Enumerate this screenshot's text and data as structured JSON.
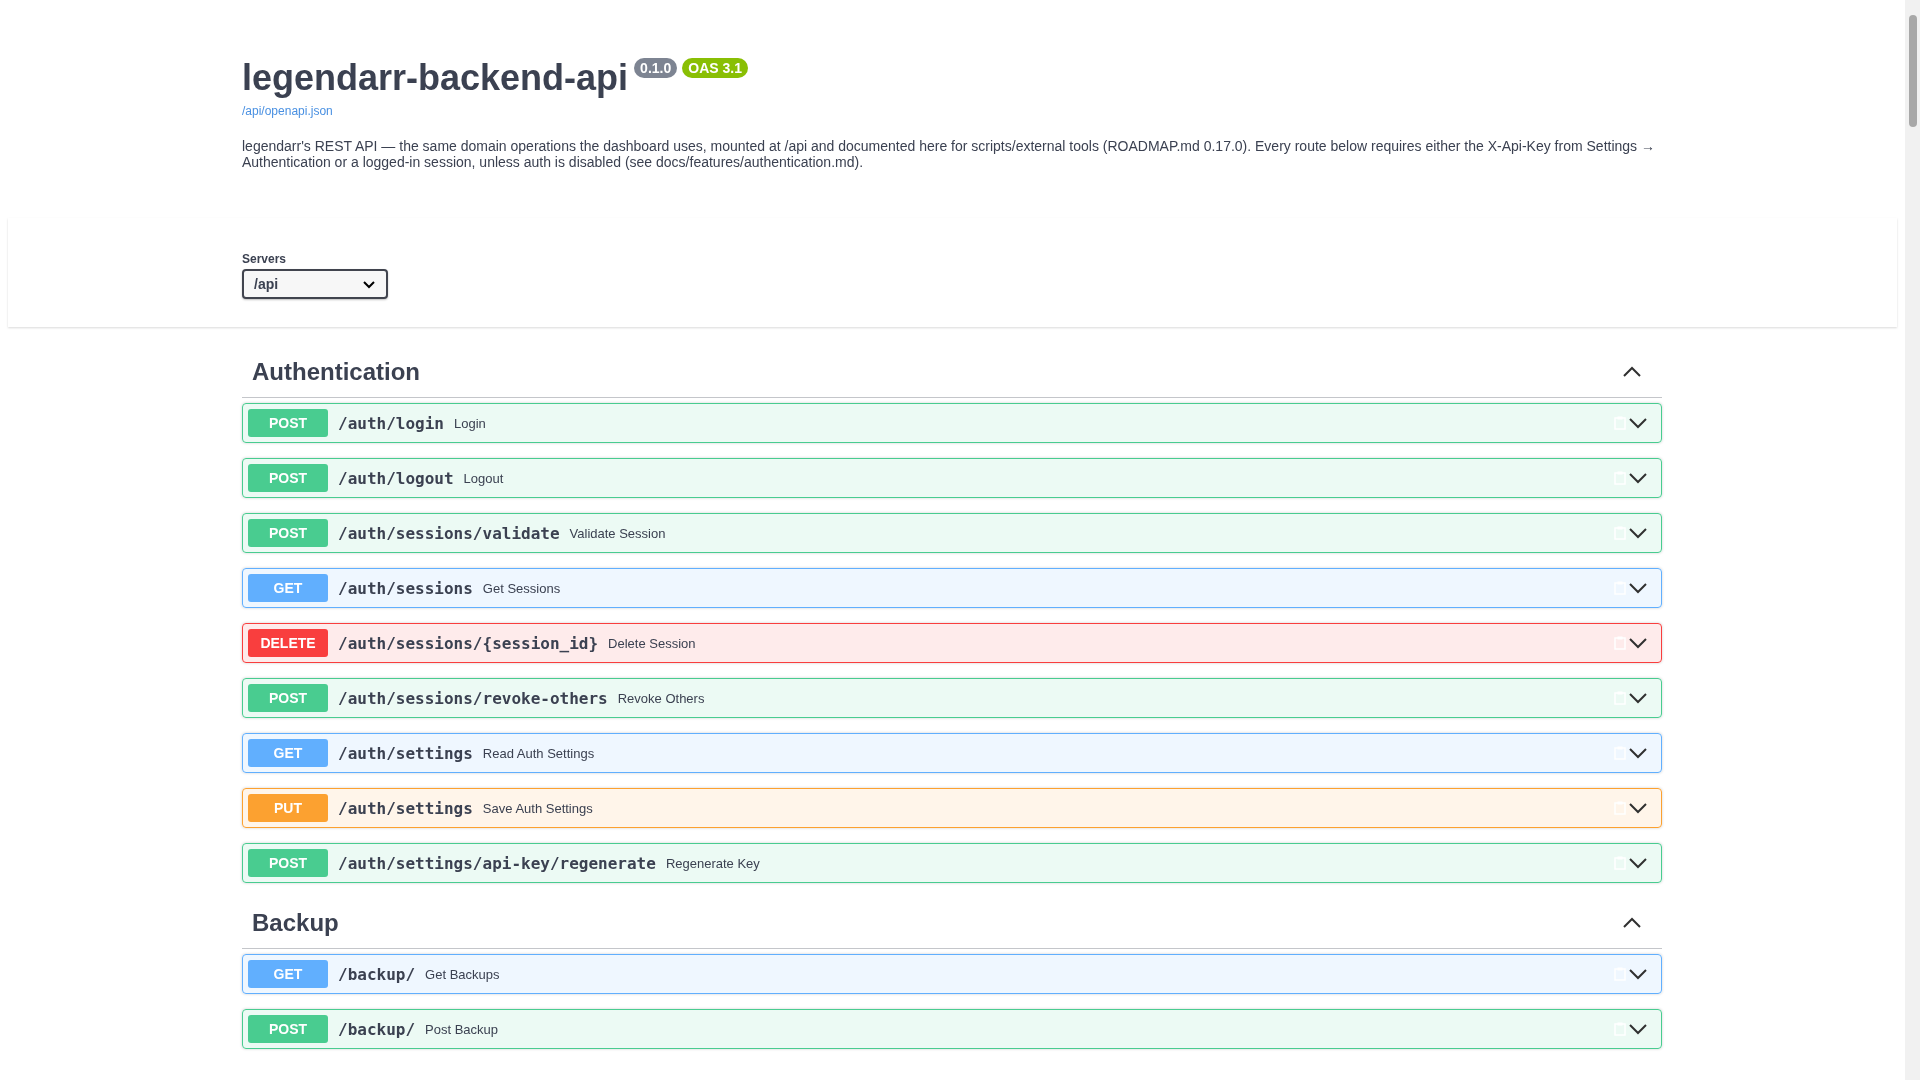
{
  "info": {
    "title": "legendarr-backend-api",
    "version": "0.1.0",
    "oas": "OAS 3.1",
    "spec_link": "/api/openapi.json",
    "description": "legendarr's REST API — the same domain operations the dashboard uses, mounted at /api and documented here for scripts/external tools (ROADMAP.md 0.17.0). Every route below requires either the X-Api-Key from Settings → Authentication or a logged-in session, unless auth is disabled (see docs/features/authentication.md)."
  },
  "servers": {
    "label": "Servers",
    "value": "/api"
  },
  "sections": [
    {
      "name": "Authentication",
      "expanded": true,
      "operations": [
        {
          "method": "POST",
          "path": "/auth/login",
          "summary": "Login"
        },
        {
          "method": "POST",
          "path": "/auth/logout",
          "summary": "Logout"
        },
        {
          "method": "POST",
          "path": "/auth/sessions/validate",
          "summary": "Validate Session"
        },
        {
          "method": "GET",
          "path": "/auth/sessions",
          "summary": "Get Sessions"
        },
        {
          "method": "DELETE",
          "path": "/auth/sessions/{session_id}",
          "summary": "Delete Session"
        },
        {
          "method": "POST",
          "path": "/auth/sessions/revoke-others",
          "summary": "Revoke Others"
        },
        {
          "method": "GET",
          "path": "/auth/settings",
          "summary": "Read Auth Settings"
        },
        {
          "method": "PUT",
          "path": "/auth/settings",
          "summary": "Save Auth Settings"
        },
        {
          "method": "POST",
          "path": "/auth/settings/api-key/regenerate",
          "summary": "Regenerate Key"
        }
      ]
    },
    {
      "name": "Backup",
      "expanded": true,
      "operations": [
        {
          "method": "GET",
          "path": "/backup/",
          "summary": "Get Backups"
        },
        {
          "method": "POST",
          "path": "/backup/",
          "summary": "Post Backup"
        }
      ]
    }
  ]
}
